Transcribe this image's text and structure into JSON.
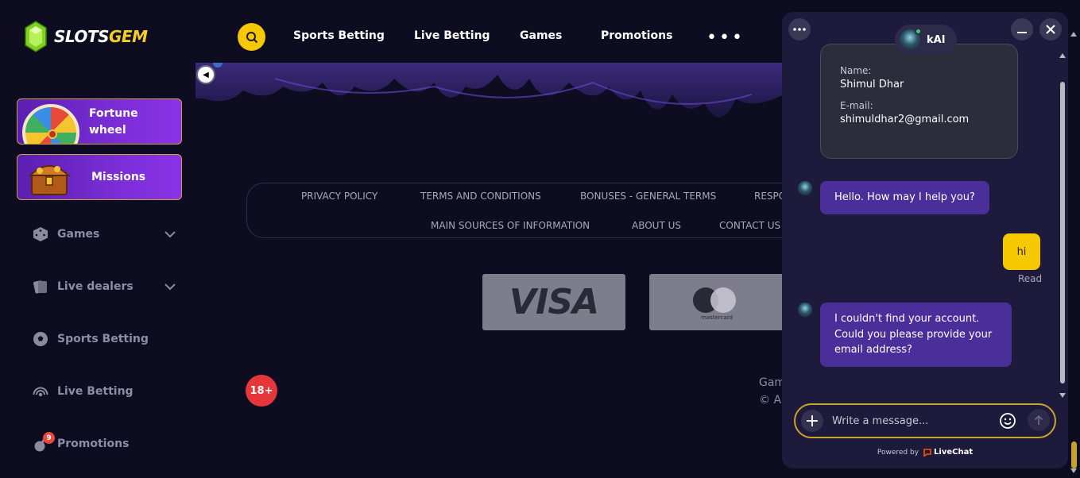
{
  "brand": {
    "logo_left": "SLOTS",
    "logo_right": "GEM"
  },
  "sidebar": {
    "promos": [
      {
        "label": "Fortune wheel"
      },
      {
        "label": "Missions"
      }
    ],
    "items": [
      {
        "label": "Games"
      },
      {
        "label": "Live dealers"
      },
      {
        "label": "Sports Betting"
      },
      {
        "label": "Live Betting"
      },
      {
        "label": "Promotions",
        "badge": "9"
      }
    ]
  },
  "topnav": {
    "links": [
      "Sports Betting",
      "Live Betting",
      "Games",
      "Promotions"
    ],
    "more": "•••"
  },
  "footer": {
    "links_row1": [
      "PRIVACY POLICY",
      "TERMS AND CONDITIONS",
      "BONUSES - GENERAL TERMS",
      "RESPO"
    ],
    "links_row2": [
      "MAIN SOURCES OF INFORMATION",
      "ABOUT US",
      "CONTACT US"
    ],
    "payments": {
      "visa": "VISA",
      "mastercard": "mastercard"
    },
    "age": "18+",
    "text1": "Gam",
    "text2": "© All"
  },
  "chat": {
    "agent_name": "kAI",
    "info": {
      "name_label": "Name:",
      "name_value": "Shimul Dhar",
      "email_label": "E-mail:",
      "email_value": "shimuldhar2@gmail.com"
    },
    "messages": [
      {
        "from": "agent",
        "text": "Hello. How may I help you?"
      },
      {
        "from": "user",
        "text": "hi",
        "status": "Read"
      },
      {
        "from": "agent",
        "text": "I couldn't find your account. Could you please provide your email address?"
      }
    ],
    "input_placeholder": "Write a message...",
    "powered_by": "Powered by",
    "powered_brand": "LiveChat"
  },
  "colors": {
    "accent": "#f5c800",
    "brand_purple": "#7a2ed6",
    "agent_bubble": "#4a2f9a",
    "background": "#0d0c21"
  }
}
